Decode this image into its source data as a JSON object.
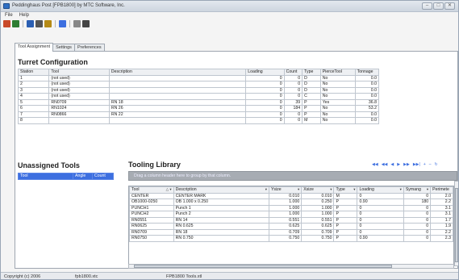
{
  "window": {
    "title": "Peddinghaus Post [FPB1800] by MTC Software, Inc.",
    "buttons": [
      "–",
      "□",
      "✕"
    ]
  },
  "menu": [
    "File",
    "Help"
  ],
  "toolbar": {
    "icons": [
      {
        "name": "new-icon",
        "color": "#c94a2a"
      },
      {
        "name": "open-icon",
        "color": "#2e7d32"
      },
      {
        "name": "save-icon",
        "color": "#2b5fb3"
      },
      {
        "name": "print-icon",
        "color": "#555555"
      },
      {
        "name": "preview-icon",
        "color": "#b58a16"
      },
      {
        "name": "settings-icon",
        "color": "#3d6fe0"
      },
      {
        "name": "copy-icon",
        "color": "#888888"
      },
      {
        "name": "search-icon",
        "color": "#444444"
      }
    ]
  },
  "tabs": [
    "Tool Assignment",
    "Settings",
    "Preferences"
  ],
  "turret": {
    "title": "Turret Configuration",
    "headers": [
      "Station",
      "Tool",
      "Description",
      "Loading",
      "Count",
      "Type",
      "PierceTool",
      "Tonnage"
    ],
    "rows": [
      [
        "1",
        "(not used)",
        "",
        "0",
        "0",
        "D",
        "No",
        "0.0"
      ],
      [
        "2",
        "(not used)",
        "",
        "0",
        "0",
        "D",
        "No",
        "0.0"
      ],
      [
        "3",
        "(not used)",
        "",
        "0",
        "0",
        "D",
        "No",
        "0.0"
      ],
      [
        "4",
        "(not used)",
        "",
        "0",
        "0",
        "C",
        "No",
        "0.0"
      ],
      [
        "5",
        "RN0709",
        "RN 18",
        "0",
        "39",
        "P",
        "Yes",
        "36.8"
      ],
      [
        "6",
        "RN1024",
        "RN 26",
        "0",
        "184",
        "P",
        "No",
        "53.2"
      ],
      [
        "7",
        "RN0866",
        "RN 22",
        "0",
        "0",
        "P",
        "No",
        "0.0"
      ],
      [
        "8",
        "",
        "",
        "0",
        "0",
        "M",
        "No",
        "0.0"
      ]
    ]
  },
  "unassigned": {
    "title": "Unassigned Tools",
    "headers": [
      "Tool",
      "Angle",
      "Count"
    ]
  },
  "library": {
    "title": "Tooling Library",
    "group_hint": "Drag a column header here to group by that column.",
    "headers": [
      "Tool",
      "Description",
      "Ysize",
      "Xsize",
      "Type",
      "Loading",
      "Symang",
      "Perimete"
    ],
    "rows": [
      [
        "CENTER",
        "CENTER MARK",
        "0.010",
        "0.010",
        "M",
        "0",
        "0",
        "2.0"
      ],
      [
        "OB1000-0250",
        "OB 1.000 x 0.250",
        "1.000",
        "0.250",
        "P",
        "0.90",
        "180",
        "2.2"
      ],
      [
        "PUNCH1",
        "Punch 1",
        "1.000",
        "1.000",
        "P",
        "0",
        "0",
        "3.1"
      ],
      [
        "PUNCH2",
        "Punch 2",
        "1.000",
        "1.000",
        "P",
        "0",
        "0",
        "3.1"
      ],
      [
        "RN0551",
        "RN 14",
        "0.551",
        "0.551",
        "P",
        "0",
        "0",
        "1.7"
      ],
      [
        "RN0625",
        "RN 0.625",
        "0.625",
        "0.625",
        "P",
        "0",
        "0",
        "1.9"
      ],
      [
        "RN0709",
        "RN 18",
        "0.709",
        "0.709",
        "P",
        "0",
        "0",
        "2.2"
      ],
      [
        "RN0750",
        "RN 0.750",
        "0.750",
        "0.750",
        "P",
        "0.90",
        "0",
        "2.3"
      ]
    ]
  },
  "nav": [
    "◀◀",
    "◀◀",
    "◀",
    "▶",
    "▶▶",
    "▶▶|",
    "+",
    "–",
    "↻"
  ],
  "status": {
    "copyright": "Copyright (c) 2006",
    "file1": "fpb1800.xtc",
    "file2": "FPB1800 Tools.xtl"
  }
}
